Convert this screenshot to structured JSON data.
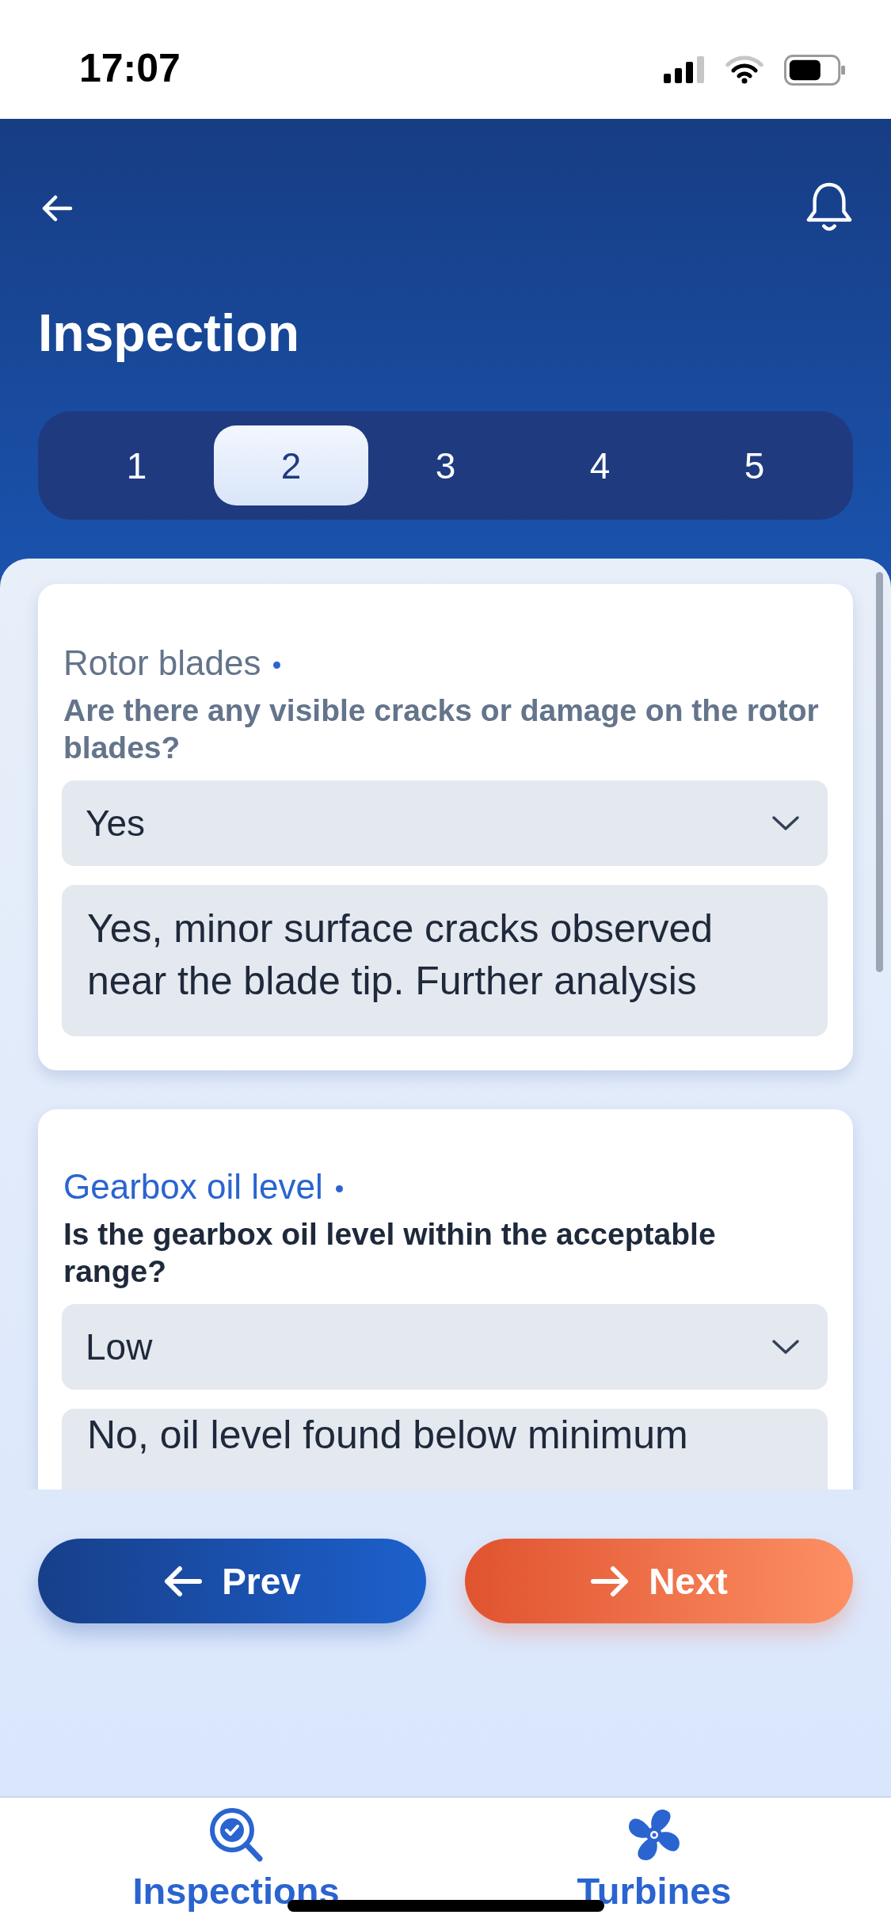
{
  "status_bar": {
    "time": "17:07"
  },
  "header": {
    "title": "Inspection"
  },
  "steps": [
    {
      "label": "1",
      "selected": false
    },
    {
      "label": "2",
      "selected": true
    },
    {
      "label": "3",
      "selected": false
    },
    {
      "label": "4",
      "selected": false
    },
    {
      "label": "5",
      "selected": false
    }
  ],
  "questions": [
    {
      "label": "Rotor blades",
      "required": true,
      "active": false,
      "question": "Are there any visible cracks or damage on the rotor blades?",
      "answer": "Yes",
      "notes": "Yes, minor surface cracks observed near the blade tip. Further analysis"
    },
    {
      "label": "Gearbox oil level",
      "required": true,
      "active": true,
      "question": "Is the gearbox oil level within the acceptable range?",
      "answer": "Low",
      "notes": "No, oil level found below minimum"
    }
  ],
  "buttons": [
    {
      "label": "Prev",
      "kind": "prev"
    },
    {
      "label": "Next",
      "kind": "next"
    }
  ],
  "tab_bar": [
    {
      "label": "Inspections",
      "kind": "inspections"
    },
    {
      "label": "Turbines",
      "kind": "turbines"
    }
  ]
}
